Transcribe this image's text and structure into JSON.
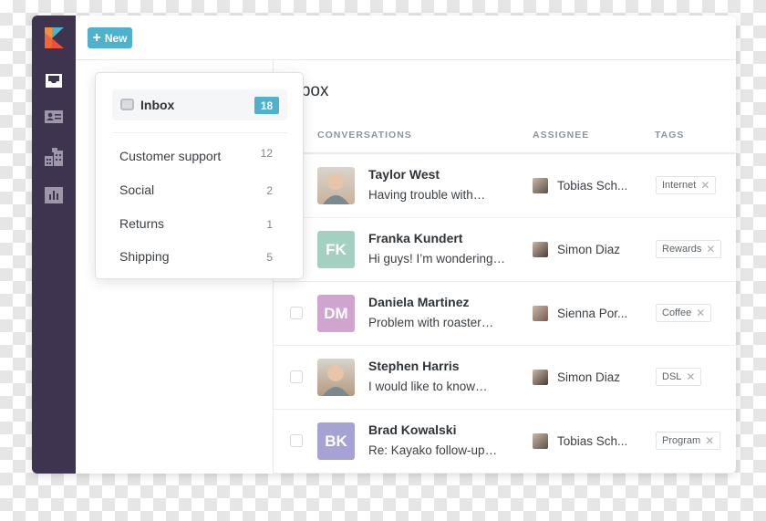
{
  "toolbar": {
    "new_label": "New"
  },
  "sidebar": {
    "items": [
      {
        "icon": "inbox-icon"
      },
      {
        "icon": "contacts-icon"
      },
      {
        "icon": "organizations-icon"
      },
      {
        "icon": "reports-icon"
      }
    ]
  },
  "dropdown": {
    "inbox": {
      "label": "Inbox",
      "count": "18"
    },
    "views": [
      {
        "label": "Customer support",
        "count": "12"
      },
      {
        "label": "Social",
        "count": "2"
      },
      {
        "label": "Returns",
        "count": "1"
      },
      {
        "label": "Shipping",
        "count": "5"
      }
    ]
  },
  "main": {
    "title": "Inbox",
    "columns": {
      "conversations": "CONVERSATIONS",
      "assignee": "ASSIGNEE",
      "tags": "TAGS"
    },
    "rows": [
      {
        "name": "Taylor West",
        "preview": "Having trouble with…",
        "initials": "",
        "avatar_color": "#c9b39a",
        "assignee": "Tobias Sch...",
        "tag": "Internet",
        "checkbox": false
      },
      {
        "name": "Franka Kundert",
        "preview": "Hi guys! I’m wondering…",
        "initials": "FK",
        "avatar_color": "#a3d0c0",
        "assignee": "Simon Diaz",
        "tag": "Rewards",
        "checkbox": false
      },
      {
        "name": "Daniela Martinez",
        "preview": "Problem with roaster…",
        "initials": "DM",
        "avatar_color": "#cfa5cf",
        "assignee": "Sienna Por...",
        "tag": "Coffee",
        "checkbox": true
      },
      {
        "name": "Stephen Harris",
        "preview": "I would like to know…",
        "initials": "",
        "avatar_color": "#b59a80",
        "assignee": "Simon Diaz",
        "tag": "DSL",
        "checkbox": true
      },
      {
        "name": "Brad Kowalski",
        "preview": "Re: Kayako follow-up…",
        "initials": "BK",
        "avatar_color": "#a5a3d3",
        "assignee": "Tobias Sch...",
        "tag": "Program",
        "checkbox": true
      }
    ]
  },
  "colors": {
    "sidebar": "#3e3450",
    "accent": "#4fb1cc"
  }
}
